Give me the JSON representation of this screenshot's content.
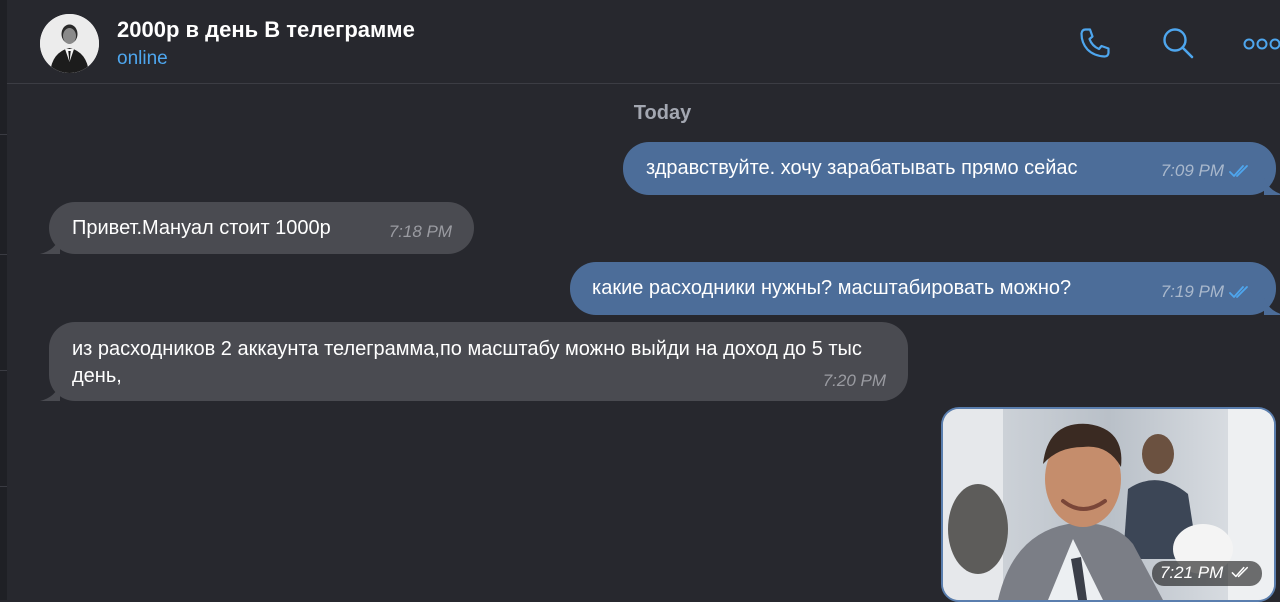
{
  "header": {
    "title": "2000р в день В телеграмме",
    "status": "online",
    "icons": [
      "phone-icon",
      "search-icon",
      "more-icon"
    ]
  },
  "chat": {
    "date_divider": "Today",
    "messages": [
      {
        "direction": "outgoing",
        "text": "здравствуйте. хочу зарабатывать прямо сейас",
        "time": "7:09 PM",
        "read": true
      },
      {
        "direction": "incoming",
        "text": "Привет.Мануал стоит 1000р",
        "time": "7:18 PM"
      },
      {
        "direction": "outgoing",
        "text": "какие расходники нужны? масштабировать можно?",
        "time": "7:19 PM",
        "read": true
      },
      {
        "direction": "incoming",
        "text": "из расходников 2 аккаунта телеграмма,по масштабу можно выйди на доход до 5 тыс день,",
        "time": "7:20 PM"
      },
      {
        "direction": "outgoing",
        "type": "media",
        "time": "7:21 PM",
        "read": true
      }
    ]
  },
  "colors": {
    "background": "#27282e",
    "outgoing_bubble": "#4c6d99",
    "incoming_bubble": "#4a4b51",
    "accent": "#4ea6ee",
    "read_ticks": "#4ea6ee"
  }
}
